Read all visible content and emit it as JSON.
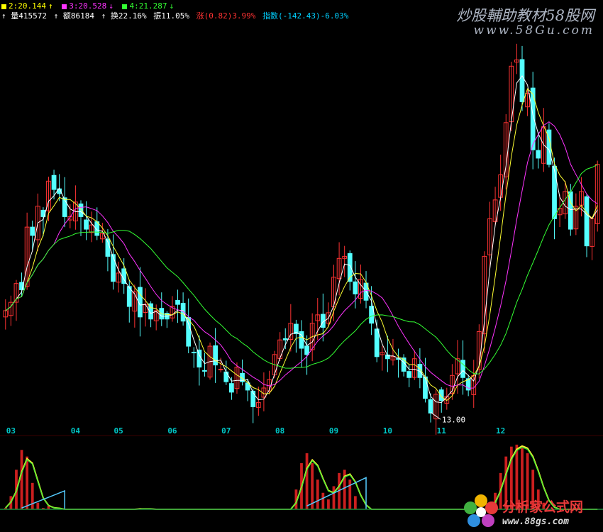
{
  "header": {
    "ma_line": [
      {
        "label": "2:20.144",
        "arrow": "↑",
        "color": "#ffff00"
      },
      {
        "label": "3:20.528",
        "arrow": "↓",
        "color": "#ff33ff"
      },
      {
        "label": "4:21.287",
        "arrow": "↓",
        "color": "#33ff33"
      }
    ],
    "stats": [
      {
        "text": "↑ 量415572",
        "color": "#ffffff"
      },
      {
        "text": "↑ 额86184",
        "color": "#ffffff"
      },
      {
        "text": "↑ 换22.16%",
        "color": "#ffffff"
      },
      {
        "text": "振11.05%",
        "color": "#ffffff"
      },
      {
        "text": "涨(0.82)3.99%",
        "color": "#ff3333"
      },
      {
        "text": "指数(-142.43)-6.03%",
        "color": "#00d0ff"
      }
    ]
  },
  "watermark": {
    "title": "炒股輔助教材58股网",
    "url": "www.58Gu.com"
  },
  "logo": {
    "title": "分析家公式网",
    "url": "www.88gs.com"
  },
  "colors": {
    "up": "#ff3333",
    "down": "#54ffff",
    "ma_short": "#ffffff",
    "ma_mid": "#ffff33",
    "ma_long": "#ff33ff",
    "ma_longer": "#33ff33",
    "axis_label": "#00c8c8"
  },
  "chart_data": [
    {
      "type": "candlestick",
      "title": "",
      "x_ticks": [
        "03",
        "04",
        "05",
        "06",
        "07",
        "08",
        "09",
        "10",
        "11",
        "12"
      ],
      "ylim": [
        12.5,
        31
      ],
      "annotations": [
        {
          "text": "13.00",
          "month": "10",
          "value": 13.0
        }
      ],
      "series": [
        {
          "role": "close",
          "values": [
            18.0,
            18.4,
            19.3,
            19.0,
            22.0,
            21.6,
            23.0,
            22.5,
            24.2,
            23.8,
            23.6,
            22.5,
            22.5,
            23.2,
            22.5,
            21.9,
            22.1,
            21.6,
            21.7,
            20.6,
            19.4,
            19.8,
            19.3,
            18.2,
            18.9,
            17.7,
            18.3,
            17.6,
            18.0,
            17.6,
            17.6,
            18.2,
            18.3,
            17.5,
            16.3,
            16.0,
            15.3,
            15.1,
            16.3,
            15.4,
            15.2,
            14.6,
            14.1,
            15.3,
            14.6,
            14.2,
            13.4,
            13.6,
            14.3,
            14.7,
            15.9,
            16.6,
            16.6,
            17.4,
            16.9,
            16.2,
            15.9,
            17.4,
            17.8,
            17.2,
            17.9,
            19.6,
            20.5,
            20.6,
            19.4,
            18.8,
            19.5,
            18.5,
            17.4,
            15.8,
            16.0,
            15.7,
            15.8,
            15.7,
            15.1,
            14.8,
            15.7,
            14.8,
            13.8,
            13.1,
            14.0,
            13.7,
            13.9,
            14.9,
            15.7,
            14.8,
            14.2,
            14.9,
            17.0,
            20.6,
            22.4,
            23.3,
            24.5,
            27.0,
            29.7,
            30.0,
            28.0,
            28.4,
            25.7,
            25.3,
            26.8,
            25.0,
            22.4,
            22.9,
            23.7,
            21.9,
            23.0,
            23.7,
            21.1,
            22.4,
            25.0
          ]
        },
        {
          "role": "volume_indicator",
          "values": [
            0.02,
            0.2,
            0.6,
            0.9,
            0.8,
            0.4,
            0.1,
            0.02,
            0.05,
            0.0,
            0.0,
            0.0,
            0.0,
            0.0,
            0.0,
            0.0,
            0.0,
            0.0,
            0.0,
            0.0,
            0.0,
            0.0,
            0.0,
            0.0,
            0.0,
            0.02,
            0.0,
            0.0,
            0.0,
            0.0,
            0.0,
            0.0,
            0.0,
            0.0,
            0.0,
            0.0,
            0.0,
            0.0,
            0.0,
            0.0,
            0.0,
            0.0,
            0.0,
            0.0,
            0.0,
            0.0,
            0.0,
            0.0,
            0.0,
            0.0,
            0.0,
            0.0,
            0.0,
            0.0,
            0.3,
            0.7,
            0.85,
            0.7,
            0.45,
            0.25,
            0.15,
            0.35,
            0.55,
            0.6,
            0.45,
            0.2,
            0.0,
            0.0,
            0.0,
            0.0,
            0.0,
            0.0,
            0.0,
            0.0,
            0.0,
            0.0,
            0.0,
            0.0,
            0.0,
            0.0,
            0.0,
            0.0,
            0.0,
            0.0,
            0.0,
            0.0,
            0.0,
            0.0,
            0.0,
            0.0,
            0.05,
            0.25,
            0.55,
            0.8,
            0.95,
            0.98,
            0.95,
            0.85,
            0.6,
            0.3,
            0.1,
            0.0,
            0.0,
            0.0,
            0.0,
            0.0,
            0.0,
            0.0,
            0.0,
            0.0,
            0.0
          ]
        }
      ]
    }
  ]
}
